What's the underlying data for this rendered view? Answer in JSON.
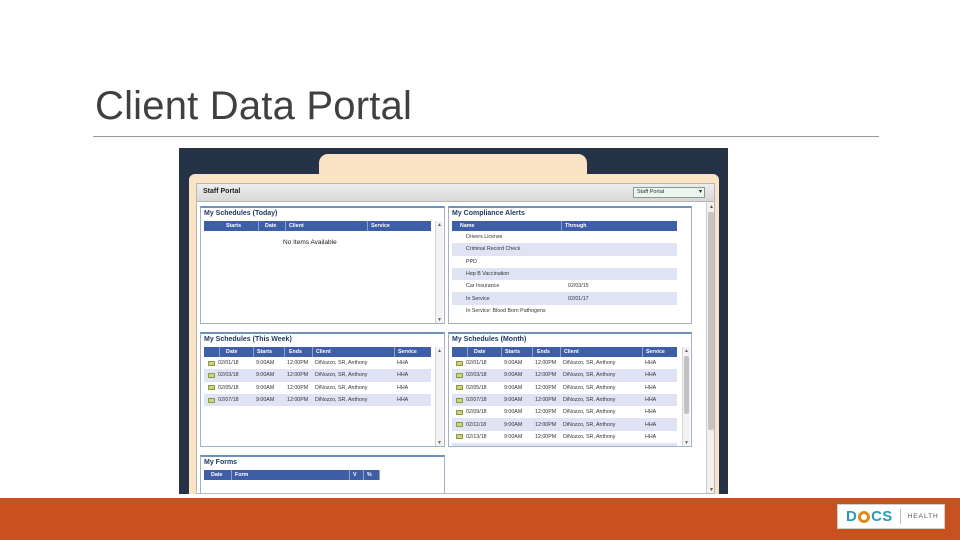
{
  "slide": {
    "title": "Client Data Portal"
  },
  "portal": {
    "title": "Staff Portal",
    "selector_value": "Staff Portal"
  },
  "schedules_today": {
    "title": "My Schedules (Today)",
    "columns": [
      "Starts",
      "Date",
      "Client",
      "Service"
    ],
    "empty_message": "No Items Available"
  },
  "compliance": {
    "title": "My Compliance Alerts",
    "columns": [
      "Name",
      "Through"
    ],
    "rows": [
      [
        "Drivers License",
        ""
      ],
      [
        "Criminal Record Check",
        ""
      ],
      [
        "PPD",
        ""
      ],
      [
        "Hep B Vaccination",
        ""
      ],
      [
        "Car Insurance",
        "02/03/15"
      ],
      [
        "In Service",
        "02/01/17"
      ],
      [
        "In Service: Blood Born Pathogens",
        ""
      ]
    ]
  },
  "schedules_week": {
    "title": "My Schedules (This Week)",
    "columns": [
      "",
      "Date",
      "Starts",
      "Ends",
      "Client",
      "Service"
    ],
    "rows": [
      [
        "02/01/18",
        "9:00AM",
        "12:00PM",
        "DiNozzo, SR, Anthony",
        "HHA"
      ],
      [
        "02/03/18",
        "9:00AM",
        "12:00PM",
        "DiNozzo, SR, Anthony",
        "HHA"
      ],
      [
        "02/05/18",
        "9:00AM",
        "12:00PM",
        "DiNozzo, SR, Anthony",
        "HHA"
      ],
      [
        "02/07/18",
        "9:00AM",
        "12:00PM",
        "DiNozzo, SR, Anthony",
        "HHA"
      ]
    ]
  },
  "schedules_month": {
    "title": "My Schedules (Month)",
    "columns": [
      "",
      "Date",
      "Starts",
      "Ends",
      "Client",
      "Service"
    ],
    "rows": [
      [
        "02/01/18",
        "9:00AM",
        "12:00PM",
        "DiNozzo, SR, Anthony",
        "HHA"
      ],
      [
        "02/03/18",
        "9:00AM",
        "12:00PM",
        "DiNozzo, SR, Anthony",
        "HHA"
      ],
      [
        "02/05/18",
        "9:00AM",
        "12:00PM",
        "DiNozzo, SR, Anthony",
        "HHA"
      ],
      [
        "02/07/18",
        "9:00AM",
        "12:00PM",
        "DiNozzo, SR, Anthony",
        "HHA"
      ],
      [
        "02/09/18",
        "9:00AM",
        "12:00PM",
        "DiNozzo, SR, Anthony",
        "HHA"
      ],
      [
        "02/11/18",
        "9:00AM",
        "12:00PM",
        "DiNozzo, SR, Anthony",
        "HHA"
      ],
      [
        "02/13/18",
        "9:00AM",
        "12:00PM",
        "DiNozzo, SR, Anthony",
        "HHA"
      ],
      [
        "02/15/18",
        "9:00AM",
        "12:00PM",
        "DiNozzo, SR, Anthony",
        "HHA"
      ]
    ]
  },
  "forms": {
    "title": "My Forms",
    "columns": [
      "Date",
      "Form",
      "V",
      "%"
    ]
  },
  "logo": {
    "word_a": "D",
    "word_b": "CS",
    "sub": "HEALTH"
  },
  "colors": {
    "footer": "#c9511f",
    "header_row": "#3f5ea8",
    "alt_row": "#dfe3f4",
    "logo_blue": "#2a9bb8",
    "logo_orange": "#e08a1e"
  }
}
